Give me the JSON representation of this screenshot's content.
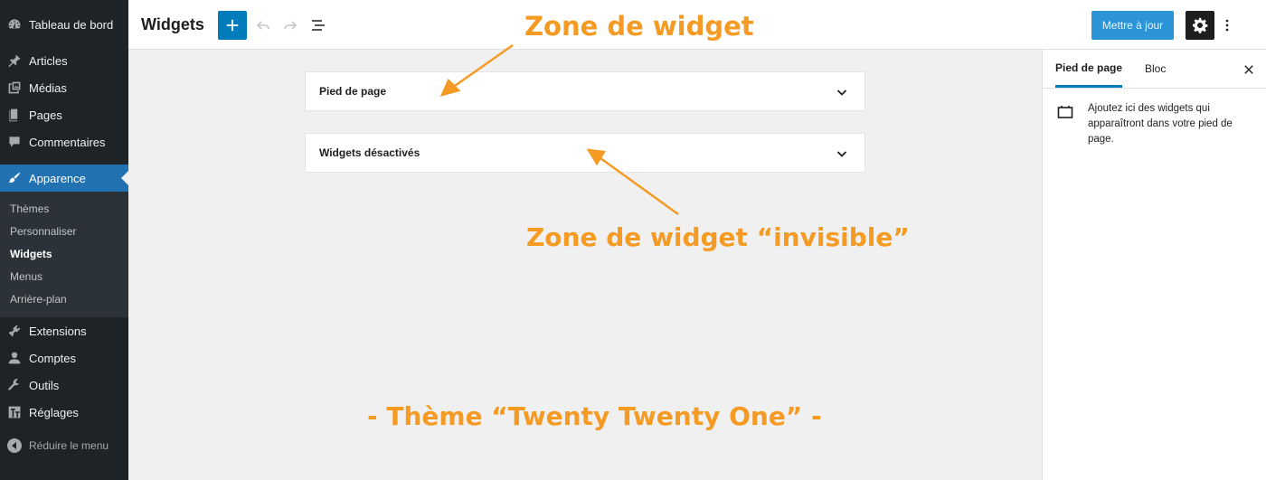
{
  "admin_menu": {
    "items": [
      {
        "label": "Tableau de bord",
        "icon": "dashboard-icon"
      },
      {
        "label": "Articles",
        "icon": "pin-icon"
      },
      {
        "label": "Médias",
        "icon": "media-icon"
      },
      {
        "label": "Pages",
        "icon": "pages-icon"
      },
      {
        "label": "Commentaires",
        "icon": "comments-icon"
      },
      {
        "label": "Apparence",
        "icon": "brush-icon",
        "current": true
      },
      {
        "label": "Extensions",
        "icon": "plugin-icon"
      },
      {
        "label": "Comptes",
        "icon": "users-icon"
      },
      {
        "label": "Outils",
        "icon": "wrench-icon"
      },
      {
        "label": "Réglages",
        "icon": "settings-sliders-icon"
      }
    ],
    "submenu": [
      {
        "label": "Thèmes"
      },
      {
        "label": "Personnaliser"
      },
      {
        "label": "Widgets",
        "current": true
      },
      {
        "label": "Menus"
      },
      {
        "label": "Arrière-plan"
      }
    ],
    "collapse_label": "Réduire le menu"
  },
  "header": {
    "title": "Widgets",
    "update_label": "Mettre à jour"
  },
  "widget_areas": [
    {
      "label": "Pied de page"
    },
    {
      "label": "Widgets désactivés"
    }
  ],
  "settings_sidebar": {
    "tabs": [
      {
        "label": "Pied de page",
        "active": true
      },
      {
        "label": "Bloc",
        "active": false
      }
    ],
    "description": "Ajoutez ici des widgets qui apparaîtront dans votre pied de page."
  },
  "annotations": {
    "zone": "Zone de widget",
    "zone_invisible": "Zone de widget “invisible”",
    "theme": "- Thème “Twenty Twenty One” -"
  },
  "colors": {
    "accent": "#007cba",
    "admin_bg": "#1d2327",
    "current_menu": "#2271b1",
    "annotation": "#f59a23"
  }
}
